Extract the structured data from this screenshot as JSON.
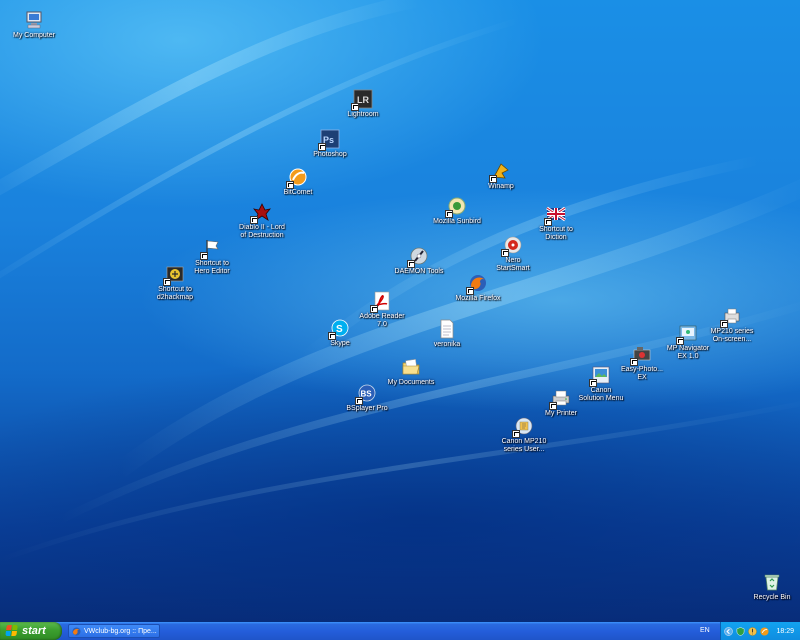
{
  "desktop": {
    "icons": [
      {
        "label": "My Computer",
        "icon": "computer-icon",
        "shortcut": false
      },
      {
        "label": "Lightroom",
        "icon": "lightroom-icon",
        "shortcut": true
      },
      {
        "label": "Photoshop",
        "icon": "photoshop-icon",
        "shortcut": true
      },
      {
        "label": "BitComet",
        "icon": "bitcomet-icon",
        "shortcut": true
      },
      {
        "label": "Winamp",
        "icon": "winamp-icon",
        "shortcut": true
      },
      {
        "label": "Diablo II - Lord\nof Destruction",
        "icon": "diablo-icon",
        "shortcut": true
      },
      {
        "label": "Mozilla Sunbird",
        "icon": "sunbird-icon",
        "shortcut": true
      },
      {
        "label": "Shortcut to\nDiction",
        "icon": "uk-flag-icon",
        "shortcut": true
      },
      {
        "label": "Shortcut to\nHero Editor",
        "icon": "flag-icon",
        "shortcut": true
      },
      {
        "label": "Nero\nStartSmart",
        "icon": "nero-icon",
        "shortcut": true
      },
      {
        "label": "DAEMON Tools",
        "icon": "daemon-tools-icon",
        "shortcut": true
      },
      {
        "label": "Shortcut to\nd2hackmap",
        "icon": "d2hackmap-icon",
        "shortcut": true
      },
      {
        "label": "Mozilla Firefox",
        "icon": "firefox-icon",
        "shortcut": true
      },
      {
        "label": "Adobe Reader\n7.0",
        "icon": "adobe-reader-icon",
        "shortcut": true
      },
      {
        "label": "MP210 series\nOn-screen...",
        "icon": "printer-manual-icon",
        "shortcut": true
      },
      {
        "label": "veronika",
        "icon": "text-file-icon",
        "shortcut": false
      },
      {
        "label": "Skype",
        "icon": "skype-icon",
        "shortcut": true
      },
      {
        "label": "MP Navigator\nEX 1.0",
        "icon": "mp-navigator-icon",
        "shortcut": true
      },
      {
        "label": "Easy-Photo...\nEX",
        "icon": "easy-photo-icon",
        "shortcut": true
      },
      {
        "label": "My Documents",
        "icon": "folder-icon",
        "shortcut": false
      },
      {
        "label": "Canon\nSolution Menu",
        "icon": "canon-menu-icon",
        "shortcut": true
      },
      {
        "label": "BSplayer Pro",
        "icon": "bsplayer-icon",
        "shortcut": true
      },
      {
        "label": "My Printer",
        "icon": "printer-icon",
        "shortcut": true
      },
      {
        "label": "Canon MP210\nseries User...",
        "icon": "canon-manual-icon",
        "shortcut": true
      },
      {
        "label": "Recycle Bin",
        "icon": "recycle-bin-icon",
        "shortcut": false
      }
    ]
  },
  "taskbar": {
    "start_label": "start",
    "window_button": "VWclub-bg.org :: Пре...",
    "language": "EN",
    "clock": "18:29"
  }
}
